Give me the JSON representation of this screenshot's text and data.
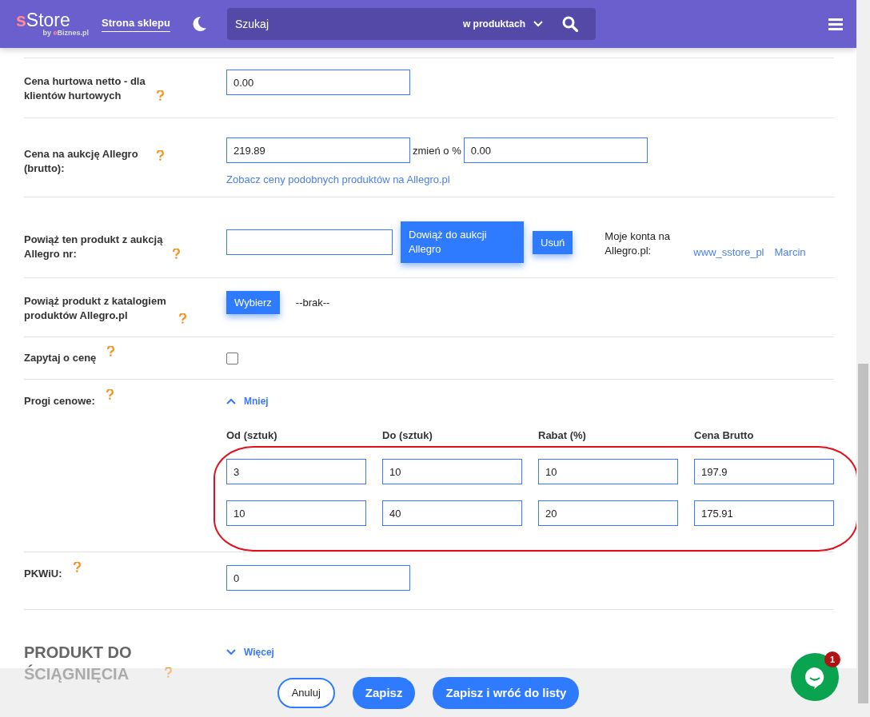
{
  "header": {
    "logo": {
      "accent": "s",
      "name": "Store",
      "by": "by",
      "brand_accent": "e",
      "brand": "Biznes.pl"
    },
    "shop_link": "Strona sklepu",
    "search": {
      "placeholder": "Szukaj",
      "scope": "w produktach"
    }
  },
  "rows": [
    {
      "kind": "input",
      "label": "Cena hurtowa netto - dla klientów hurtowych",
      "value": "0.00"
    },
    {
      "kind": "allegro_price",
      "label": "Cena na aukcję Allegro (brutto):",
      "value": "219.89",
      "change_label": "zmień o %",
      "change_value": "0.00",
      "link": "Zobacz ceny podobnych produktów na Allegro.pl"
    },
    {
      "kind": "auction",
      "label": "Powiąż ten produkt z aukcją Allegro nr:",
      "buttons": [
        "Dowiąż do aukcji Allegro",
        "Usuń"
      ],
      "accounts_label": "Moje konta na Allegro.pl:",
      "accounts": [
        "www_sstore_pl",
        "Marcin"
      ]
    },
    {
      "kind": "catalog",
      "label": "Powiąż produkt z katalogiem produktów Allegro.pl",
      "button": "Wybierz",
      "status": "--brak--"
    },
    {
      "kind": "checkbox",
      "label": "Zapytaj o cenę",
      "checked": false
    },
    {
      "kind": "tiers",
      "label": "Progi cenowe:",
      "toggle": {
        "label": "Mniej",
        "expanded": true
      },
      "columns": [
        "Od (sztuk)",
        "Do (sztuk)",
        "Rabat (%)",
        "Cena Brutto"
      ],
      "highlighted": true,
      "tiers": [
        [
          "3",
          "10",
          "10",
          "197.9"
        ],
        [
          "10",
          "40",
          "20",
          "175.91"
        ]
      ]
    },
    {
      "kind": "input",
      "label": "PKWiU:",
      "value": "0"
    }
  ],
  "section": {
    "title": "PRODUKT DO ŚCIĄGNIĘCIA",
    "toggle": {
      "label": "Więcej",
      "expanded": false
    }
  },
  "footer": {
    "buttons": [
      {
        "label": "Anuluj",
        "kind": "outline"
      },
      {
        "label": "Zapisz",
        "kind": "primary"
      },
      {
        "label": "Zapisz i wróć do listy",
        "kind": "primary"
      }
    ]
  },
  "chat": {
    "badge": "1"
  }
}
